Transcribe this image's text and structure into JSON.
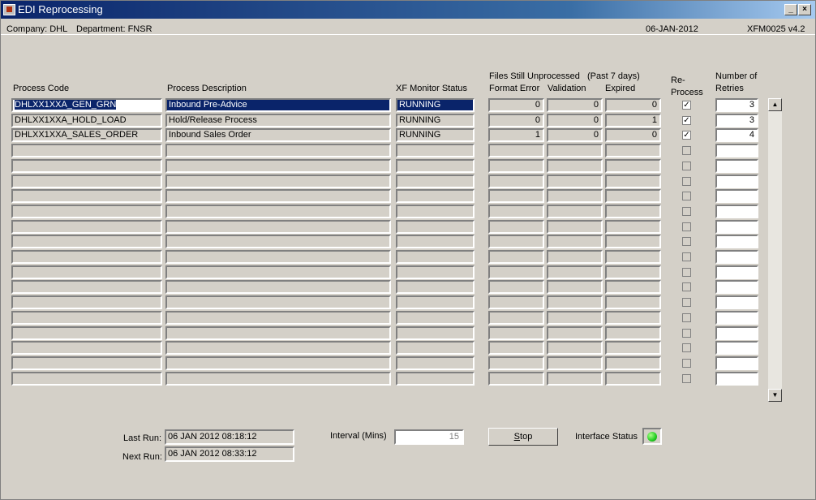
{
  "window": {
    "title": "EDI Reprocessing"
  },
  "info": {
    "company": "Company:  DHL",
    "department": "Department:  FNSR",
    "date": "06-JAN-2012",
    "form_id": "XFM0025  v4.2"
  },
  "headers": {
    "process_code": "Process Code",
    "process_desc": "Process Description",
    "monitor_status": "XF Monitor Status",
    "files_unprocessed": "Files Still Unprocessed",
    "past_days": "(Past 7 days)",
    "format_error": "Format Error",
    "validation": "Validation",
    "expired": "Expired",
    "reprocess_1": "Re-",
    "reprocess_2": "Process",
    "retries_1": "Number of",
    "retries_2": "Retries"
  },
  "rows": [
    {
      "code": "DHLXX1XXA_GEN_GRN",
      "desc": "Inbound Pre-Advice",
      "status": "RUNNING",
      "format_error": "0",
      "validation": "0",
      "expired": "0",
      "reprocess": true,
      "retries": "3"
    },
    {
      "code": "DHLXX1XXA_HOLD_LOAD",
      "desc": "Hold/Release Process",
      "status": "RUNNING",
      "format_error": "0",
      "validation": "0",
      "expired": "1",
      "reprocess": true,
      "retries": "3"
    },
    {
      "code": "DHLXX1XXA_SALES_ORDER",
      "desc": "Inbound Sales Order",
      "status": "RUNNING",
      "format_error": "1",
      "validation": "0",
      "expired": "0",
      "reprocess": true,
      "retries": "4"
    }
  ],
  "checkmark": "✓",
  "footer": {
    "last_run_label": "Last Run:",
    "last_run_value": "06 JAN 2012 08:18:12",
    "next_run_label": "Next Run:",
    "next_run_value": "06 JAN 2012 08:33:12",
    "interval_label": "Interval (Mins)",
    "interval_value": "15",
    "stop_button_accel": "S",
    "stop_button_rest": "top",
    "interface_status_label": "Interface Status",
    "interface_status_color": "#22cc22"
  },
  "colors": {
    "selection": "#0a246a",
    "form_bg": "#d4d0c8"
  }
}
